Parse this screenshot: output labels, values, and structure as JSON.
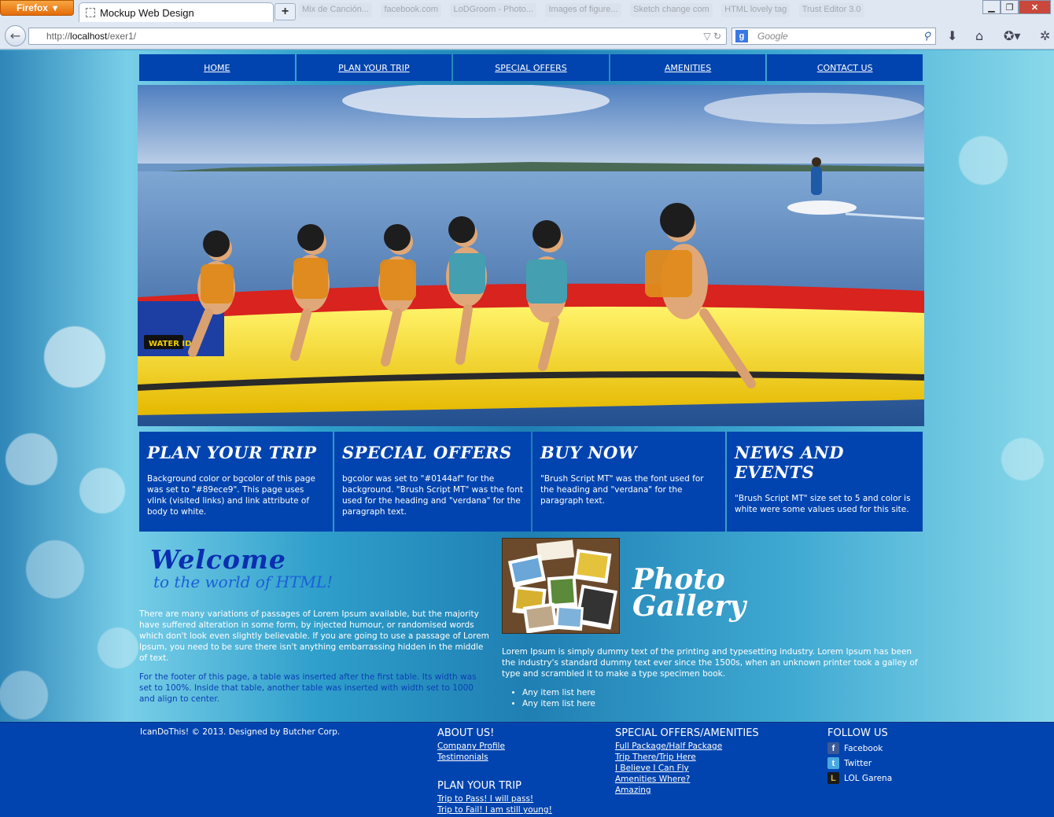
{
  "browser": {
    "app_button": "Firefox",
    "tab_title": "Mockup Web Design",
    "new_tab_label": "+",
    "url_prefix": "http://",
    "url_host": "localhost",
    "url_path": "/exer1/",
    "search_placeholder": "Google",
    "search_engine_letter": "g",
    "background_tabs": [
      "Mix de Canción...",
      "facebook.com",
      "LoDGroom - Photo...",
      "Images of figure...",
      "Sketch change com",
      "HTML lovely tag",
      "Trust Editor 3.0"
    ]
  },
  "nav": [
    "HOME",
    "PLAN YOUR TRIP",
    "SPECIAL OFFERS",
    "AMENITIES",
    "CONTACT US"
  ],
  "boxes": [
    {
      "title": "Plan Your Trip",
      "text": "Background color or bgcolor of this page was set to \"#89ece9\". This page uses vlink (visited links) and link attribute of body to white."
    },
    {
      "title": "Special Offers",
      "text": "bgcolor was set to \"#0144af\" for the background. \"Brush Script MT\" was the font used for the heading and \"verdana\" for the paragraph text."
    },
    {
      "title": "Buy Now",
      "text": "\"Brush Script MT\" was the font used for the heading and \"verdana\" for the paragraph text."
    },
    {
      "title": "News and Events",
      "text": "\"Brush Script MT\" size set to 5 and color is white were some values used for this site."
    }
  ],
  "welcome": {
    "heading": "Welcome",
    "subheading": "to the world of HTML!",
    "paragraph1": "There are many variations of passages of Lorem Ipsum available, but the majority have suffered alteration in some form, by injected humour, or randomised words which don't look even slightly believable. If you are going to use a passage of Lorem Ipsum, you need to be sure there isn't anything embarrassing hidden in the middle of text.",
    "paragraph2": "For the footer of this page, a table was inserted after the first table. Its width was set to 100%. Inside that table, another table was inserted with width set to 1000 and align to center."
  },
  "gallery": {
    "title_line1": "Photo",
    "title_line2": "Gallery",
    "text": "Lorem Ipsum is simply dummy text of the printing and typesetting industry. Lorem Ipsum has been the industry's standard dummy text ever since the 1500s, when an unknown printer took a galley of type and scrambled it to make a type specimen book.",
    "list": [
      "Any item list here",
      "Any item list here"
    ]
  },
  "hero": {
    "boat_label": "WATER ID"
  },
  "footer": {
    "copyright": "IcanDoThis! © 2013. Designed by Butcher Corp.",
    "about": {
      "heading": "ABOUT US!",
      "links": [
        "Company Profile",
        "Testimonials"
      ]
    },
    "plan": {
      "heading": "PLAN YOUR TRIP",
      "links": [
        "Trip to Pass! I will pass!",
        "Trip to Fail! I am still young!"
      ]
    },
    "offers": {
      "heading": "SPECIAL OFFERS/AMENITIES",
      "links": [
        "Full Package/Half Package",
        "Trip There/Trip Here",
        "I Believe I Can Fly",
        "Amenities Where?",
        "Amazing"
      ]
    },
    "follow": {
      "heading": "FOLLOW US",
      "items": [
        {
          "label": "Facebook",
          "icon": "facebook-icon",
          "glyph": "f",
          "color": "#3b5998"
        },
        {
          "label": "Twitter",
          "icon": "twitter-icon",
          "glyph": "t",
          "color": "#4aa8e0"
        },
        {
          "label": "LOL Garena",
          "icon": "lol-garena-icon",
          "glyph": "L",
          "color": "#1a1a1a"
        }
      ]
    }
  },
  "colors": {
    "nav_bg": "#0144af",
    "page_bg": "#89ece9",
    "link": "#ffffff"
  }
}
